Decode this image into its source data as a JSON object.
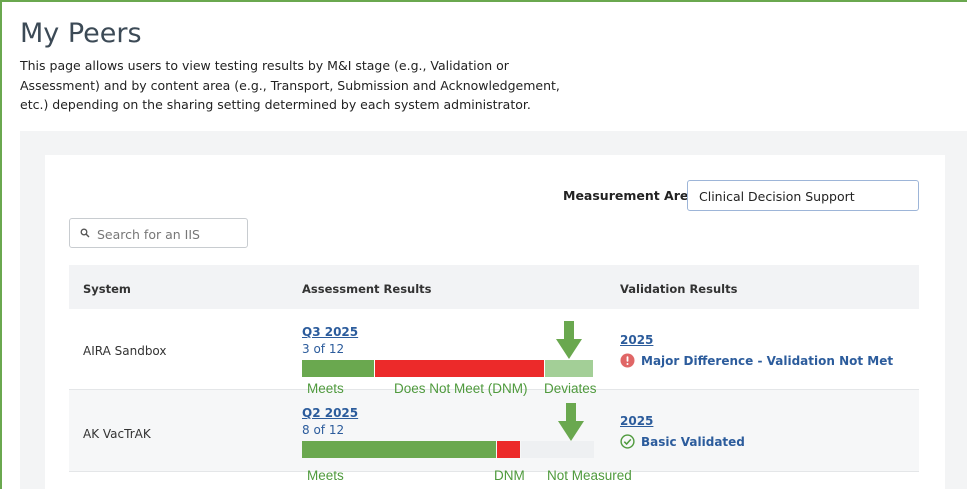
{
  "page": {
    "title": "My Peers",
    "description": "This page allows users to view testing results by M&I stage (e.g., Validation or Assessment) and by content area (e.g., Transport, Submission and Acknowledgement, etc.) depending on the sharing setting determined by each system administrator."
  },
  "filters": {
    "measurement_label": "Measurement Area:",
    "measurement_value": "Clinical Decision Support",
    "search_placeholder": "Search for an IIS"
  },
  "table": {
    "columns": [
      "System",
      "Assessment Results",
      "Validation Results"
    ],
    "rows": [
      {
        "system": "AIRA Sandbox",
        "assessment_period": "Q3 2025",
        "assessment_count": "3 of 12",
        "bar": {
          "meets": 3,
          "dnm": 7,
          "deviates": 2,
          "not_measured": 0,
          "total": 12
        },
        "validation_year": "2025",
        "validation_status": "Major Difference - Validation Not Met",
        "validation_icon": "exclamation-circle-icon"
      },
      {
        "system": "AK VacTrAK",
        "assessment_period": "Q2 2025",
        "assessment_count": "8 of 12",
        "bar": {
          "meets": 8,
          "dnm": 1,
          "deviates": 0,
          "not_measured": 3,
          "total": 12
        },
        "validation_year": "2025",
        "validation_status": "Basic Validated",
        "validation_icon": "check-circle-icon"
      }
    ]
  },
  "annotations": {
    "row1": [
      "Meets",
      "Does Not Meet (DNM)",
      "Deviates"
    ],
    "row2": [
      "Meets",
      "DNM",
      "Not Measured"
    ]
  },
  "colors": {
    "meets": "#6aa84f",
    "dnm": "#ec2a2a",
    "deviates": "#a3cf97",
    "not_measured": "#eef0f2",
    "annotation": "#4f9a3d",
    "link": "#2c5c9c",
    "error": "#e06666",
    "success": "#4f9a3d"
  }
}
